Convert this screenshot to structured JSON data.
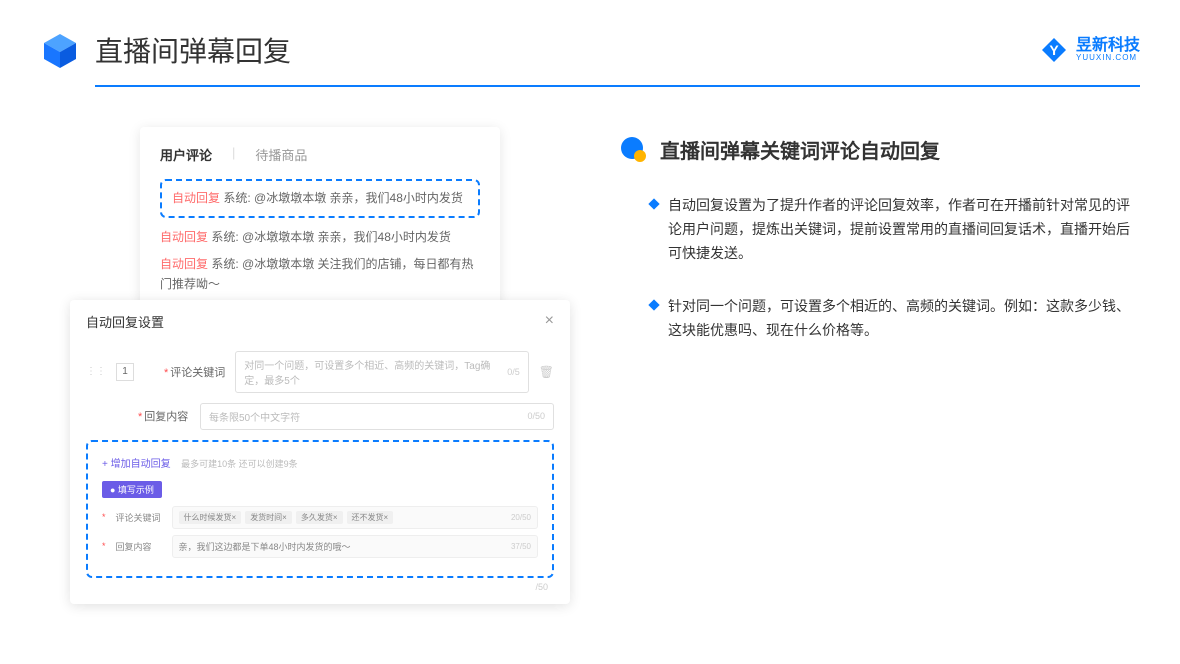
{
  "header": {
    "title": "直播间弹幕回复",
    "brand_cn": "昱新科技",
    "brand_en": "YUUXIN.COM"
  },
  "card1": {
    "tab_active": "用户评论",
    "tab_inactive": "待播商品",
    "highlighted_prefix": "自动回复",
    "highlighted_text": " 系统: @冰墩墩本墩 亲亲，我们48小时内发货",
    "line2_prefix": "自动回复",
    "line2_text": " 系统: @冰墩墩本墩 亲亲，我们48小时内发货",
    "line3_prefix": "自动回复",
    "line3_text": " 系统: @冰墩墩本墩 关注我们的店铺，每日都有热门推荐呦～"
  },
  "card2": {
    "title": "自动回复设置",
    "close": "×",
    "index": "1",
    "label_keyword": "评论关键词",
    "placeholder_keyword": "对同一个问题，可设置多个相近、高频的关键词，Tag确定，最多5个",
    "counter_keyword": "0/5",
    "label_reply": "回复内容",
    "placeholder_reply": "每条限50个中文字符",
    "counter_reply": "0/50",
    "add_link": "+ 增加自动回复",
    "add_hint": "最多可建10条 还可以创建9条",
    "example_badge": "● 填写示例",
    "ex_label_keyword": "评论关键词",
    "ex_tags": [
      "什么时候发货×",
      "发货时间×",
      "多久发货×",
      "还不发货×"
    ],
    "ex_counter_keyword": "20/50",
    "ex_label_reply": "回复内容",
    "ex_reply_text": "亲，我们这边都是下单48小时内发货的哦～",
    "ex_counter_reply": "37/50",
    "outer_counter": "/50"
  },
  "right": {
    "section_title": "直播间弹幕关键词评论自动回复",
    "bullet1": "自动回复设置为了提升作者的评论回复效率，作者可在开播前针对常见的评论用户问题，提炼出关键词，提前设置常用的直播间回复话术，直播开始后可快捷发送。",
    "bullet2": "针对同一个问题，可设置多个相近的、高频的关键词。例如：这款多少钱、这块能优惠吗、现在什么价格等。"
  }
}
